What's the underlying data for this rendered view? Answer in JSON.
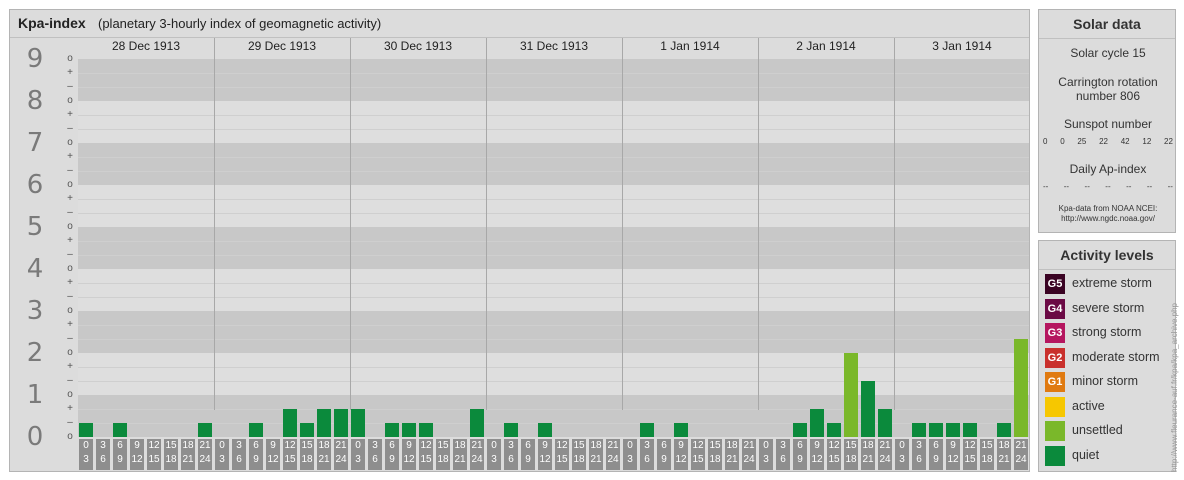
{
  "header": {
    "title": "Kpa-index",
    "subtitle": "(planetary 3-hourly index of geomagnetic activity)"
  },
  "y_axis": {
    "labels": [
      "9",
      "8",
      "7",
      "6",
      "5",
      "4",
      "3",
      "2",
      "1",
      "0"
    ],
    "sub_marks": [
      "o",
      "–",
      "+"
    ]
  },
  "days": [
    "28 Dec 1913",
    "29 Dec 1913",
    "30 Dec 1913",
    "31 Dec 1913",
    "1 Jan 1914",
    "2 Jan 1914",
    "3 Jan 1914"
  ],
  "time_slots": [
    {
      "top": "0",
      "bottom": "3"
    },
    {
      "top": "3",
      "bottom": "6"
    },
    {
      "top": "6",
      "bottom": "9"
    },
    {
      "top": "9",
      "bottom": "12"
    },
    {
      "top": "12",
      "bottom": "15"
    },
    {
      "top": "15",
      "bottom": "18"
    },
    {
      "top": "18",
      "bottom": "21"
    },
    {
      "top": "21",
      "bottom": "24"
    }
  ],
  "colors": {
    "quiet": "#0b8a3c",
    "unsettled": "#7ab82a",
    "active": "#f6c700",
    "g1": "#e07a10",
    "g2": "#c9302c",
    "g3": "#b5165f",
    "g4": "#6b0a45",
    "g5": "#3a0323"
  },
  "chart_data": {
    "type": "bar",
    "title": "Kpa-index",
    "subtitle": "(planetary 3-hourly index of geomagnetic activity)",
    "ylim": [
      0,
      9
    ],
    "categories": [
      "28 Dec 1913",
      "29 Dec 1913",
      "30 Dec 1913",
      "31 Dec 1913",
      "1 Jan 1914",
      "2 Jan 1914",
      "3 Jan 1914"
    ],
    "series": [
      {
        "values": [
          0.333,
          0.0,
          0.333,
          0.0,
          0.0,
          0.0,
          0.0,
          0.333
        ]
      },
      {
        "values": [
          0.0,
          0.0,
          0.333,
          0.0,
          0.667,
          0.333,
          0.667,
          0.667
        ]
      },
      {
        "values": [
          0.667,
          0.0,
          0.333,
          0.333,
          0.333,
          0.0,
          0.0,
          0.667
        ]
      },
      {
        "values": [
          0.0,
          0.333,
          0.0,
          0.333,
          0.0,
          0.0,
          0.0,
          0.0
        ]
      },
      {
        "values": [
          0.0,
          0.333,
          0.0,
          0.333,
          0.0,
          0.0,
          0.0,
          0.0
        ]
      },
      {
        "values": [
          0.0,
          0.0,
          0.333,
          0.667,
          0.333,
          2.0,
          1.333,
          0.667
        ]
      },
      {
        "values": [
          0.0,
          0.333,
          0.333,
          0.333,
          0.333,
          0.0,
          0.333,
          2.333
        ]
      }
    ],
    "grid": true
  },
  "solar": {
    "title": "Solar data",
    "cycle": "Solar cycle 15",
    "carrington_line1": "Carrington rotation",
    "carrington_line2": "number 806",
    "sunspot_label": "Sunspot number",
    "sunspot_values": [
      "0",
      "0",
      "25",
      "22",
      "42",
      "12",
      "22"
    ],
    "ap_label": "Daily Ap-index",
    "ap_values": [
      "--",
      "--",
      "--",
      "--",
      "--",
      "--",
      "--"
    ],
    "source_line1": "Kpa-data from NOAA NCEI:",
    "source_line2": "http://www.ngdc.noaa.gov/"
  },
  "activity": {
    "title": "Activity levels",
    "levels": [
      {
        "badge": "G5",
        "label": "extreme storm"
      },
      {
        "badge": "G4",
        "label": "severe storm"
      },
      {
        "badge": "G3",
        "label": "strong storm"
      },
      {
        "badge": "G2",
        "label": "moderate storm"
      },
      {
        "badge": "G1",
        "label": "minor storm"
      },
      {
        "badge": "",
        "label": "active"
      },
      {
        "badge": "",
        "label": "unsettled"
      },
      {
        "badge": "",
        "label": "quiet"
      }
    ]
  },
  "credit": "http://www.fleurance-auf.fr/kpa/kpa_archive.php"
}
